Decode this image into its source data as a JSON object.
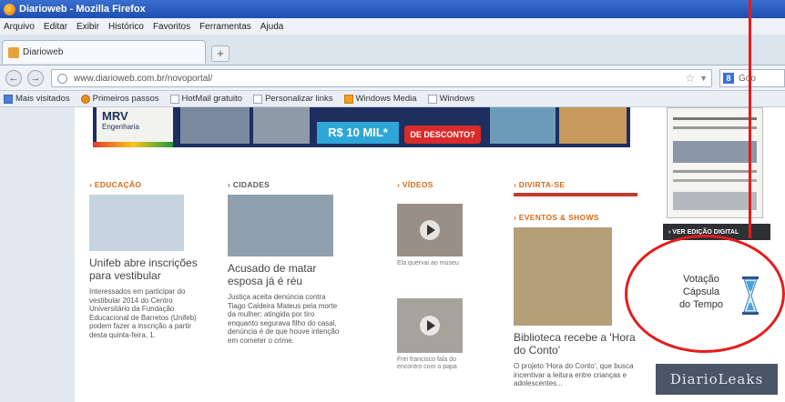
{
  "window": {
    "title": "Diarioweb - Mozilla Firefox"
  },
  "menu": [
    "Arquivo",
    "Editar",
    "Exibir",
    "Histórico",
    "Favoritos",
    "Ferramentas",
    "Ajuda"
  ],
  "tab": {
    "label": "Diarioweb",
    "new_tab": "+"
  },
  "nav": {
    "back": "←",
    "forward": "→",
    "url": "www.diarioweb.com.br/novoportal/",
    "search_placeholder": "Goo"
  },
  "bookmarks": [
    "Mais visitados",
    "Primeiros passos",
    "HotMail gratuito",
    "Personalizar links",
    "Windows Media",
    "Windows"
  ],
  "banner": {
    "brand": "MRV",
    "brand_sub": "Engenharia",
    "price": "R$ 10 MIL*",
    "tag": "DE DESCONTO?"
  },
  "columns": [
    {
      "section": "› EDUCAÇÃO",
      "headline": "Unifeb abre inscrições para vestibular",
      "summary": "Interessados em participar do vestibular 2014 do Centro Universitário da Fundação Educacional de Barretos (Unifeb) podem fazer a inscrição a partir desta quinta-feira, 1."
    },
    {
      "section": "› CIDADES",
      "headline": "Acusado de matar esposa já é réu",
      "summary": "Justiça aceita denúncia contra Tiago Caldeira Mateus pela morte da mulher; atingida por tiro enquanto segurava filho do casal, denúncia é de que houve intenção em cometer o crime."
    },
    {
      "section": "› VÍDEOS",
      "caption1": "Ela quervai ao museu",
      "caption2": "Frei francisco fala do encontro com o papa"
    },
    {
      "section": "› DIVIRTA-SE",
      "subsection": "› EVENTOS & SHOWS",
      "headline": "Biblioteca recebe a 'Hora do Conto'",
      "summary": "O projeto 'Hora do Conto', que busca incentivar a leitura entre crianças e adolescentes..."
    }
  ],
  "sidebar": {
    "edition_button": "› VER EDIÇÃO DIGITAL",
    "vote_line1": "Votação",
    "vote_line2": "Cápsula",
    "vote_line3": "do Tempo",
    "leaks": "DiarioLeaks"
  },
  "colors": {
    "annotation": "#e41c1c",
    "section_orange": "#d86a1a"
  }
}
